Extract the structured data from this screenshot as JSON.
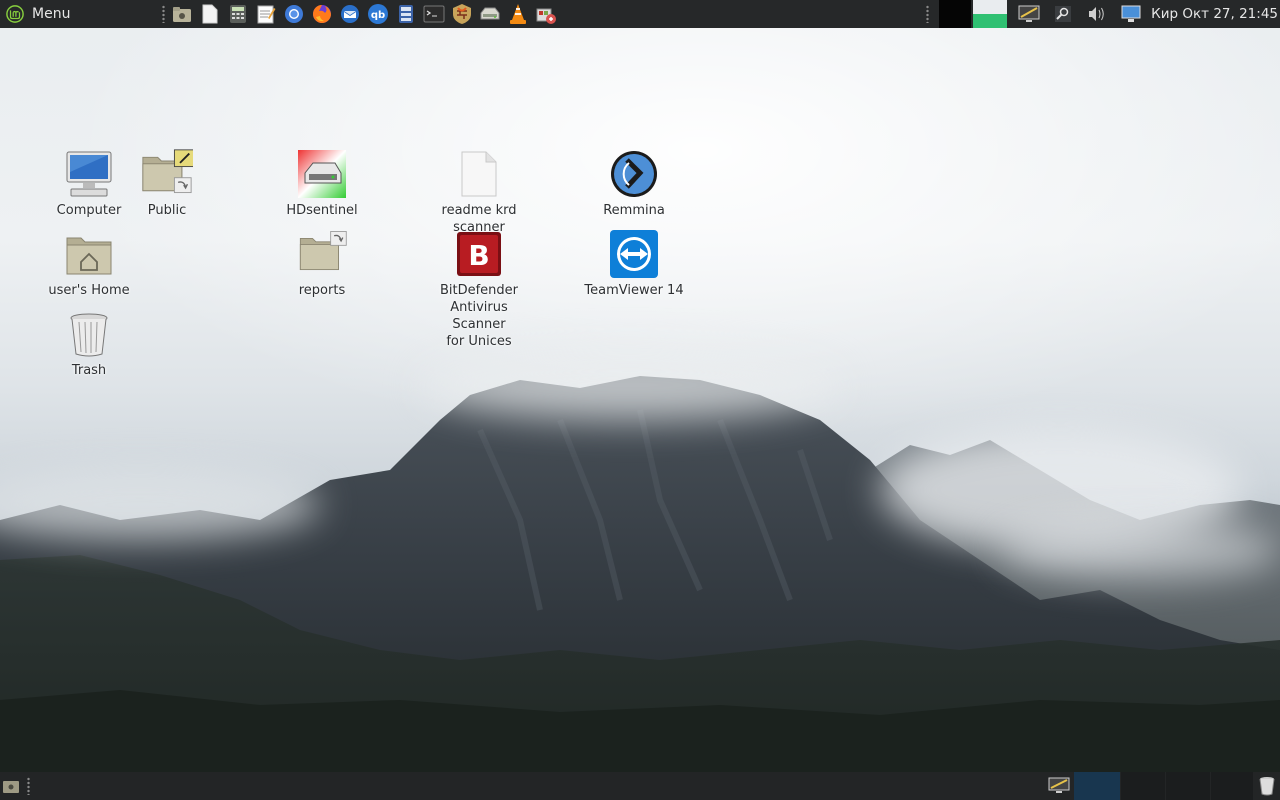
{
  "top_panel": {
    "menu_label": "Menu",
    "launchers": [
      {
        "name": "file-manager-launcher",
        "icon": "folder-camera-icon"
      },
      {
        "name": "text-file-launcher",
        "icon": "document-icon"
      },
      {
        "name": "calculator-launcher",
        "icon": "calculator-icon"
      },
      {
        "name": "text-editor-launcher",
        "icon": "notepad-icon"
      },
      {
        "name": "chromium-launcher",
        "icon": "chromium-icon"
      },
      {
        "name": "firefox-launcher",
        "icon": "firefox-icon"
      },
      {
        "name": "mail-launcher",
        "icon": "mail-icon"
      },
      {
        "name": "qbittorrent-launcher",
        "icon": "qbittorrent-icon",
        "text": "qb"
      },
      {
        "name": "file-roller-launcher",
        "icon": "archive-icon"
      },
      {
        "name": "terminal-launcher",
        "icon": "terminal-icon"
      },
      {
        "name": "gufw-launcher",
        "icon": "firewall-icon"
      },
      {
        "name": "disk-launcher",
        "icon": "disk-icon"
      },
      {
        "name": "vlc-launcher",
        "icon": "vlc-cone-icon"
      },
      {
        "name": "software-manager-launcher",
        "icon": "software-icon"
      }
    ],
    "clock": "Кир Окт 27, 21:45"
  },
  "desktop_icons": [
    {
      "label": "Computer",
      "icon": "computer-icon"
    },
    {
      "label": "Public",
      "icon": "folder-shared-icon"
    },
    {
      "label": "HDsentinel",
      "icon": "hdsentinel-icon"
    },
    {
      "label": "readme krd scanner",
      "icon": "text-file-icon"
    },
    {
      "label": "Remmina",
      "icon": "remmina-icon"
    },
    {
      "label": "user's Home",
      "icon": "home-folder-icon"
    },
    {
      "label": "reports",
      "icon": "folder-link-icon"
    },
    {
      "label_lines": [
        "BitDefender",
        "Antivirus Scanner",
        "for Unices"
      ],
      "icon": "bitdefender-icon"
    },
    {
      "label": "TeamViewer 14",
      "icon": "teamviewer-icon"
    },
    {
      "label": "Trash",
      "icon": "trash-icon"
    }
  ],
  "colors": {
    "panel": "#262829",
    "panel_text": "#e6e6e6",
    "mint_green": "#87cf3e"
  }
}
